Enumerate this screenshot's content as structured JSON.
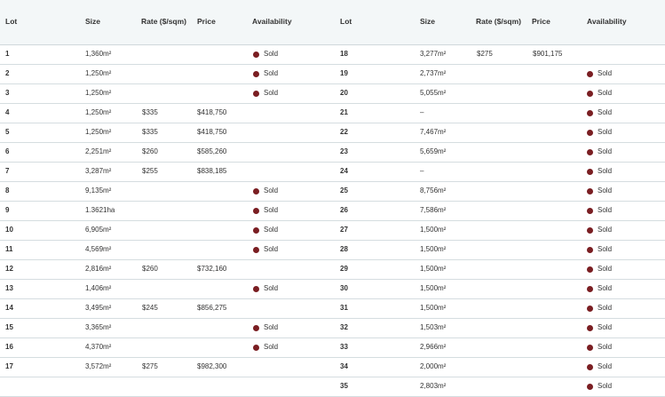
{
  "theme": {
    "header_bg": "#f3f7f8",
    "sold_dot": "#7a1e22",
    "border": "#d5dde0"
  },
  "icons": {
    "sold_indicator": "sold-dot-icon"
  },
  "headers": {
    "left": {
      "lot": "Lot",
      "size": "Size",
      "rate": "Rate ($/sqm)",
      "price": "Price",
      "availability": "Availability"
    },
    "right": {
      "lot": "Lot",
      "size": "Size",
      "rate": "Rate ($/sqm)",
      "price": "Price",
      "availability": "Availability"
    }
  },
  "left_rows": [
    {
      "lot": "1",
      "size": "1,360m²",
      "rate": "",
      "price": "",
      "availability": "Sold"
    },
    {
      "lot": "2",
      "size": "1,250m²",
      "rate": "",
      "price": "",
      "availability": "Sold"
    },
    {
      "lot": "3",
      "size": "1,250m²",
      "rate": "",
      "price": "",
      "availability": "Sold"
    },
    {
      "lot": "4",
      "size": "1,250m²",
      "rate": "$335",
      "price": "$418,750",
      "availability": ""
    },
    {
      "lot": "5",
      "size": "1,250m²",
      "rate": "$335",
      "price": "$418,750",
      "availability": ""
    },
    {
      "lot": "6",
      "size": "2,251m²",
      "rate": "$260",
      "price": "$585,260",
      "availability": ""
    },
    {
      "lot": "7",
      "size": "3,287m²",
      "rate": "$255",
      "price": "$838,185",
      "availability": ""
    },
    {
      "lot": "8",
      "size": "9,135m²",
      "rate": "",
      "price": "",
      "availability": "Sold"
    },
    {
      "lot": "9",
      "size": "1.3621ha",
      "rate": "",
      "price": "",
      "availability": "Sold"
    },
    {
      "lot": "10",
      "size": "6,905m²",
      "rate": "",
      "price": "",
      "availability": "Sold"
    },
    {
      "lot": "11",
      "size": "4,569m²",
      "rate": "",
      "price": "",
      "availability": "Sold"
    },
    {
      "lot": "12",
      "size": "2,816m²",
      "rate": "$260",
      "price": "$732,160",
      "availability": ""
    },
    {
      "lot": "13",
      "size": "1,406m²",
      "rate": "",
      "price": "",
      "availability": "Sold"
    },
    {
      "lot": "14",
      "size": "3,495m²",
      "rate": "$245",
      "price": "$856,275",
      "availability": ""
    },
    {
      "lot": "15",
      "size": "3,365m²",
      "rate": "",
      "price": "",
      "availability": "Sold"
    },
    {
      "lot": "16",
      "size": "4,370m²",
      "rate": "",
      "price": "",
      "availability": "Sold"
    },
    {
      "lot": "17",
      "size": "3,572m²",
      "rate": "$275",
      "price": "$982,300",
      "availability": ""
    }
  ],
  "right_rows": [
    {
      "lot": "18",
      "size": "3,277m²",
      "rate": "$275",
      "price": "$901,175",
      "availability": ""
    },
    {
      "lot": "19",
      "size": "2,737m²",
      "rate": "",
      "price": "",
      "availability": "Sold"
    },
    {
      "lot": "20",
      "size": "5,055m²",
      "rate": "",
      "price": "",
      "availability": "Sold"
    },
    {
      "lot": "21",
      "size": "–",
      "rate": "",
      "price": "",
      "availability": "Sold"
    },
    {
      "lot": "22",
      "size": "7,467m²",
      "rate": "",
      "price": "",
      "availability": "Sold"
    },
    {
      "lot": "23",
      "size": "5,659m²",
      "rate": "",
      "price": "",
      "availability": "Sold"
    },
    {
      "lot": "24",
      "size": "–",
      "rate": "",
      "price": "",
      "availability": "Sold"
    },
    {
      "lot": "25",
      "size": "8,756m²",
      "rate": "",
      "price": "",
      "availability": "Sold"
    },
    {
      "lot": "26",
      "size": "7,586m²",
      "rate": "",
      "price": "",
      "availability": "Sold"
    },
    {
      "lot": "27",
      "size": "1,500m²",
      "rate": "",
      "price": "",
      "availability": "Sold"
    },
    {
      "lot": "28",
      "size": "1,500m²",
      "rate": "",
      "price": "",
      "availability": "Sold"
    },
    {
      "lot": "29",
      "size": "1,500m²",
      "rate": "",
      "price": "",
      "availability": "Sold"
    },
    {
      "lot": "30",
      "size": "1,500m²",
      "rate": "",
      "price": "",
      "availability": "Sold"
    },
    {
      "lot": "31",
      "size": "1,500m²",
      "rate": "",
      "price": "",
      "availability": "Sold"
    },
    {
      "lot": "32",
      "size": "1,503m²",
      "rate": "",
      "price": "",
      "availability": "Sold"
    },
    {
      "lot": "33",
      "size": "2,966m²",
      "rate": "",
      "price": "",
      "availability": "Sold"
    },
    {
      "lot": "34",
      "size": "2,000m²",
      "rate": "",
      "price": "",
      "availability": "Sold"
    },
    {
      "lot": "35",
      "size": "2,803m²",
      "rate": "",
      "price": "",
      "availability": "Sold"
    }
  ]
}
